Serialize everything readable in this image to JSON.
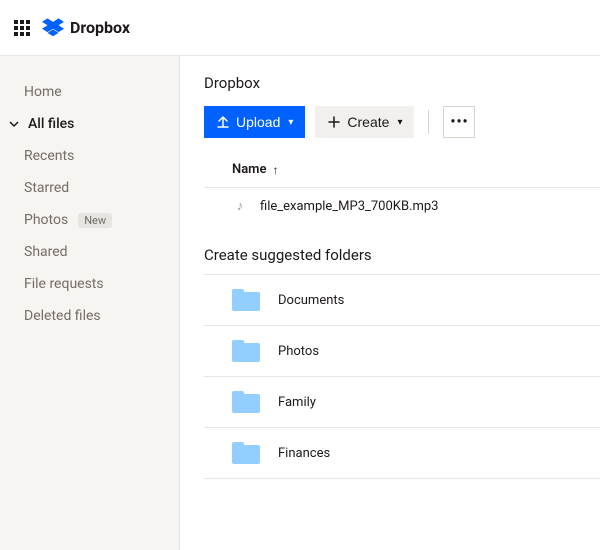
{
  "brand": {
    "name": "Dropbox"
  },
  "sidebar": {
    "items": [
      {
        "label": "Home"
      },
      {
        "label": "All files"
      },
      {
        "label": "Recents"
      },
      {
        "label": "Starred"
      },
      {
        "label": "Photos",
        "badge": "New"
      },
      {
        "label": "Shared"
      },
      {
        "label": "File requests"
      },
      {
        "label": "Deleted files"
      }
    ]
  },
  "breadcrumb": "Dropbox",
  "toolbar": {
    "upload_label": "Upload",
    "create_label": "Create",
    "more_label": "•••"
  },
  "columns": {
    "name": "Name"
  },
  "files": [
    {
      "name": "file_example_MP3_700KB.mp3",
      "type": "audio"
    }
  ],
  "suggested": {
    "heading": "Create suggested folders",
    "folders": [
      {
        "name": "Documents"
      },
      {
        "name": "Photos"
      },
      {
        "name": "Family"
      },
      {
        "name": "Finances"
      }
    ]
  }
}
